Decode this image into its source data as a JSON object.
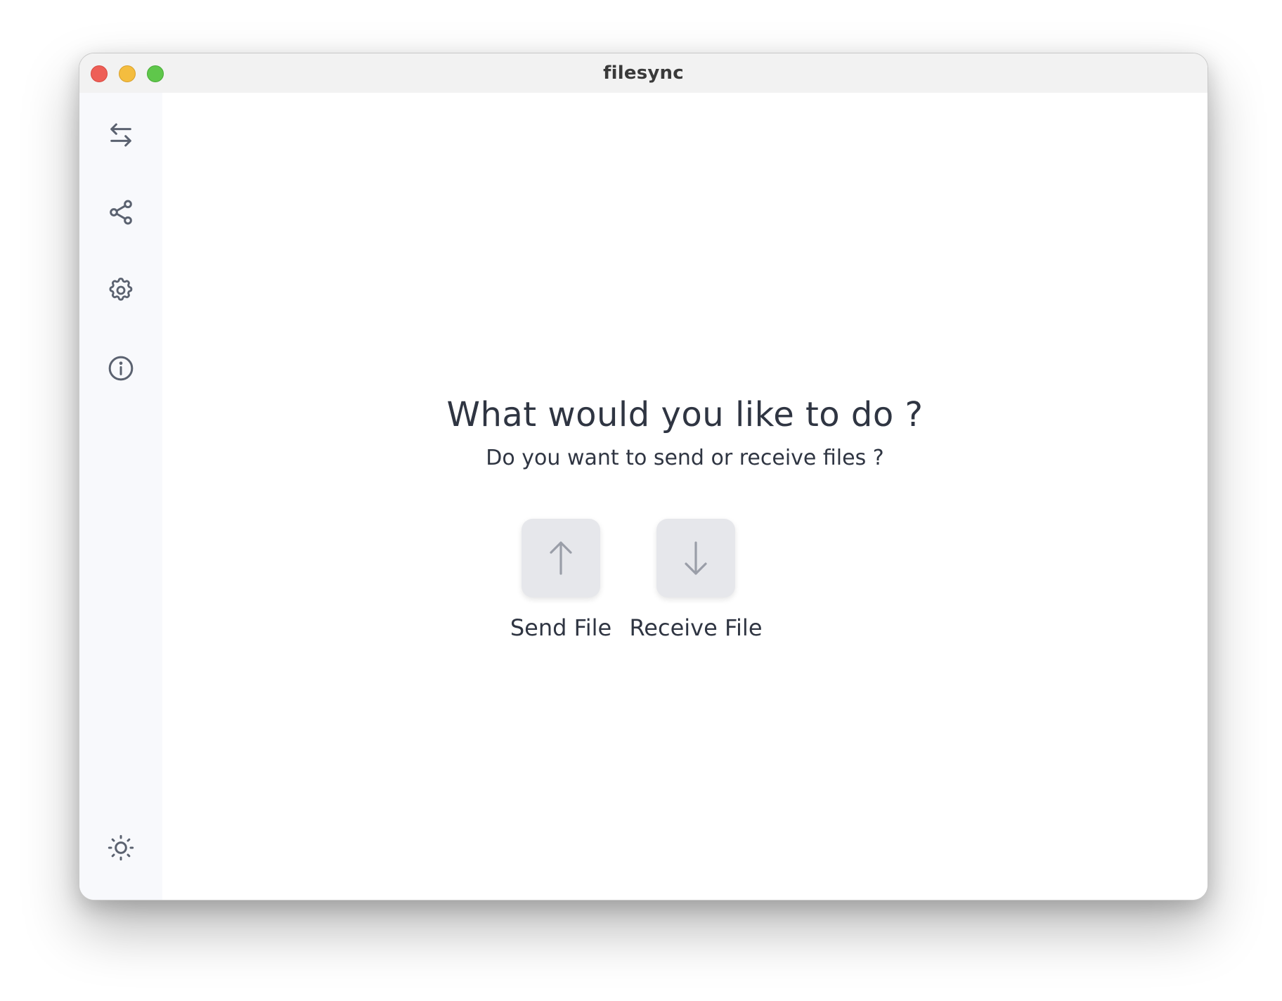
{
  "window": {
    "title": "filesync"
  },
  "sidebar": {
    "items": [
      {
        "icon": "transfer-arrows-icon"
      },
      {
        "icon": "share-icon"
      },
      {
        "icon": "gear-icon"
      },
      {
        "icon": "info-icon"
      }
    ],
    "footer_icon": "sun-icon"
  },
  "main": {
    "heading": "What would you like to do ?",
    "subheading": "Do you want to send or receive files ?",
    "actions": [
      {
        "label": "Send File",
        "icon": "arrow-up-icon"
      },
      {
        "label": "Receive File",
        "icon": "arrow-down-icon"
      }
    ]
  },
  "colors": {
    "icon": "#5b6270",
    "text": "#2f3542",
    "sidebar_bg": "#f8f9fc",
    "button_bg": "#e6e7eb",
    "button_icon": "#9a9ea8"
  }
}
